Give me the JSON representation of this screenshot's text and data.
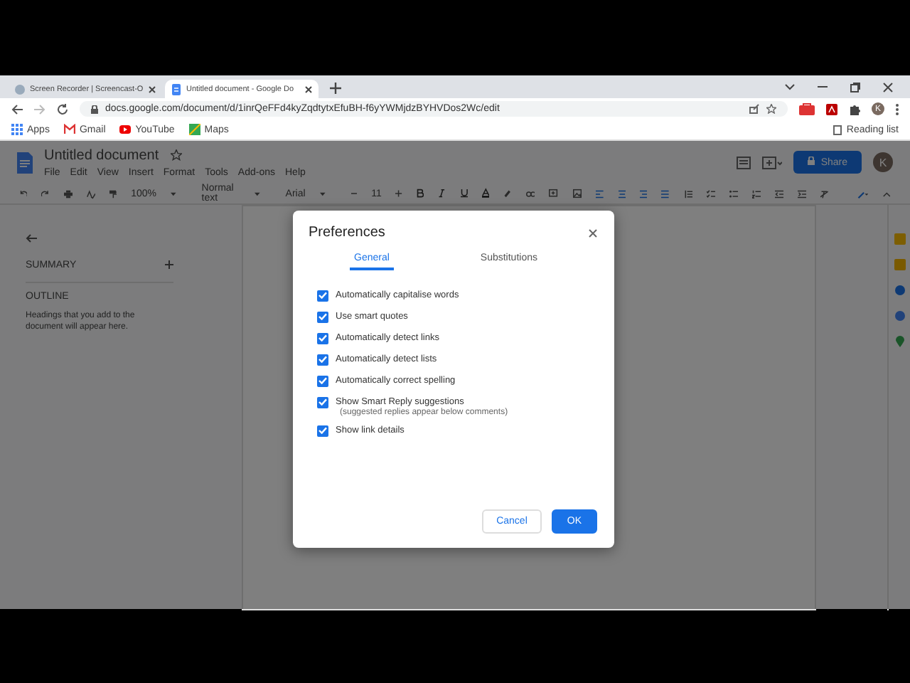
{
  "browser": {
    "tabs": [
      {
        "title": "Screen Recorder | Screencast-O",
        "selected": false
      },
      {
        "title": "Untitled document - Google Do",
        "selected": true
      }
    ],
    "url": "docs.google.com/document/d/1inrQeFFd4kyZqdtytxEfuBH-f6yYWMjdzBYHVDos2Wc/edit",
    "bookmarks": [
      {
        "label": "Apps",
        "kind": "apps"
      },
      {
        "label": "Gmail",
        "kind": "mail"
      },
      {
        "label": "YouTube",
        "kind": "video"
      },
      {
        "label": "Maps",
        "kind": "map"
      }
    ],
    "reading_list": "Reading list",
    "avatar": "K"
  },
  "docs": {
    "title": "Untitled document",
    "menu": [
      "File",
      "Edit",
      "View",
      "Insert",
      "Format",
      "Tools",
      "Add-ons",
      "Help"
    ],
    "toolbar": {
      "zoom": "100%",
      "style": "Normal text",
      "font": "Arial",
      "size": "11"
    },
    "share": "Share",
    "avatar": "K",
    "outline": {
      "summary": "SUMMARY",
      "heading": "OUTLINE",
      "hint": "Headings that you add to the document will appear here."
    }
  },
  "dialog": {
    "title": "Preferences",
    "tabs": [
      {
        "label": "General",
        "selected": true
      },
      {
        "label": "Substitutions",
        "selected": false
      }
    ],
    "options": [
      {
        "label": "Automatically capitalise words",
        "checked": true
      },
      {
        "label": "Use smart quotes",
        "checked": true
      },
      {
        "label": "Automatically detect links",
        "checked": true
      },
      {
        "label": "Automatically detect lists",
        "checked": true
      },
      {
        "label": "Automatically correct spelling",
        "checked": true
      },
      {
        "label": "Show Smart Reply suggestions",
        "checked": true,
        "note": "(suggested replies appear below comments)"
      },
      {
        "label": "Show link details",
        "checked": true
      }
    ],
    "cancel": "Cancel",
    "ok": "OK"
  }
}
